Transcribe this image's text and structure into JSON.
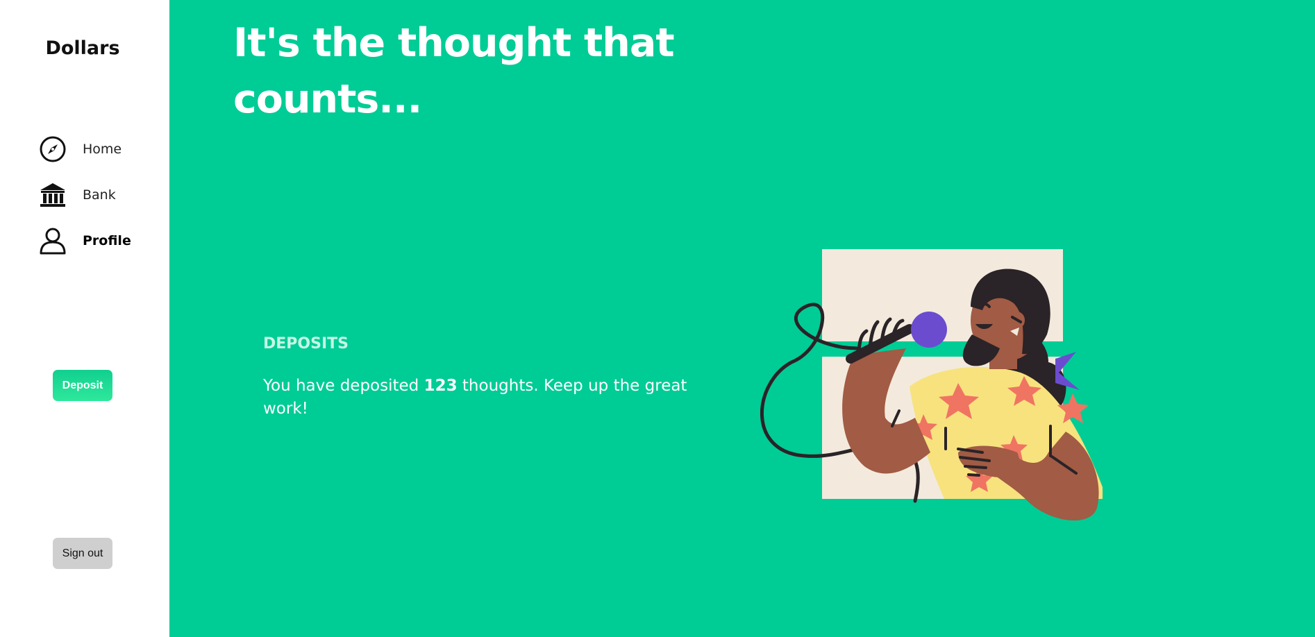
{
  "app": {
    "brand": "Dollars"
  },
  "sidebar": {
    "items": [
      {
        "label": "Home",
        "icon": "compass-icon",
        "active": false
      },
      {
        "label": "Bank",
        "icon": "bank-icon",
        "active": false
      },
      {
        "label": "Profile",
        "icon": "user-icon",
        "active": true
      }
    ],
    "deposit_label": "Deposit",
    "signout_label": "Sign out"
  },
  "main": {
    "headline": "It's the thought that counts...",
    "section_title": "DEPOSITS",
    "deposit_text_before": "You have deposited ",
    "deposit_count": "123",
    "deposit_text_after": " thoughts. Keep up the great work!"
  },
  "colors": {
    "accent": "#00cc96",
    "sidebar_bg": "#ffffff",
    "deposit_button": "#11cf8f",
    "signout_button": "#cfcfcf"
  }
}
